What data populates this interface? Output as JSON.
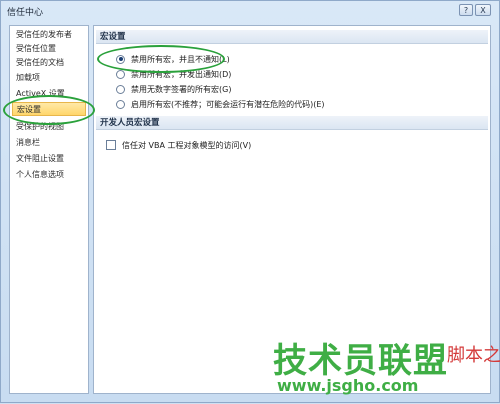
{
  "window": {
    "title": "信任中心",
    "help_button": "?",
    "close_button": "X"
  },
  "sidebar": {
    "items": [
      {
        "label": "受信任的发布者"
      },
      {
        "label": "受信任位置"
      },
      {
        "label": "受信任的文档"
      },
      {
        "label": "加载项"
      },
      {
        "label": "ActiveX 设置"
      },
      {
        "label": "宏设置",
        "selected": true
      },
      {
        "label": "受保护的视图"
      },
      {
        "label": "消息栏"
      },
      {
        "label": "文件阻止设置"
      },
      {
        "label": "个人信息选项"
      }
    ]
  },
  "macro_settings": {
    "title": "宏设置",
    "options": [
      {
        "label": "禁用所有宏，并且不通知(L)",
        "selected": true
      },
      {
        "label": "禁用所有宏，并发出通知(D)",
        "selected": false
      },
      {
        "label": "禁用无数字签署的所有宏(G)",
        "selected": false
      },
      {
        "label": "启用所有宏(不推荐；可能会运行有潜在危险的代码)(E)",
        "selected": false
      }
    ]
  },
  "developer_settings": {
    "title": "开发人员宏设置",
    "trust_vba_label": "信任对 VBA 工程对象模型的访问(V)",
    "trust_vba_checked": false
  },
  "watermark": {
    "main": "技术员联盟",
    "url": "www.jsgho.com",
    "side": "脚本之家"
  },
  "colors": {
    "highlight": "#2aa13b",
    "selected_item": "#ffd66b",
    "watermark_green": "#3fae45"
  }
}
